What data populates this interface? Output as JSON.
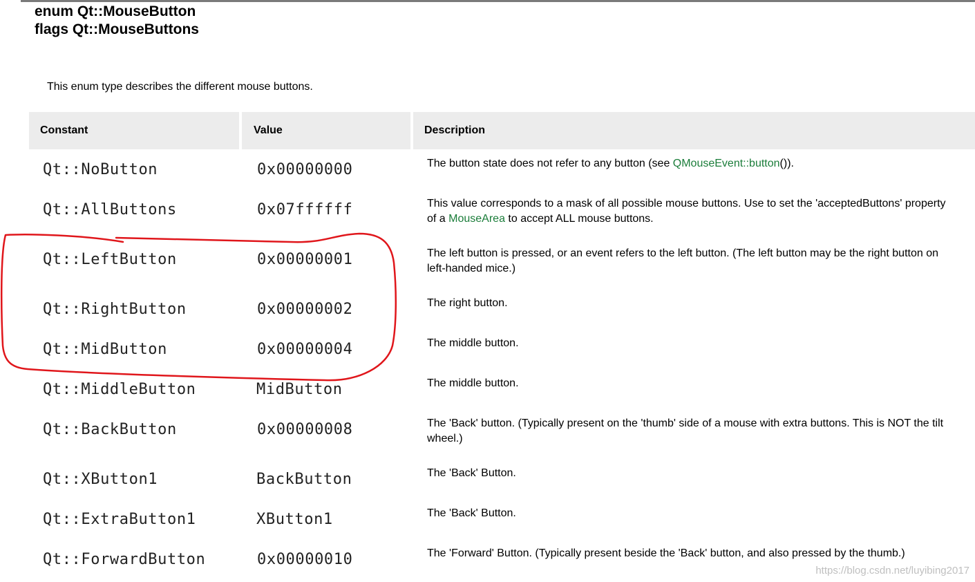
{
  "header": {
    "enum_line": "enum Qt::MouseButton",
    "flags_line": "flags Qt::MouseButtons"
  },
  "intro": "This enum type describes the different mouse buttons.",
  "table": {
    "columns": [
      "Constant",
      "Value",
      "Description"
    ],
    "rows": [
      {
        "constant": "Qt::NoButton",
        "value": "0x00000000",
        "desc": [
          {
            "text": "The button state does not refer to any button (see "
          },
          {
            "text": "QMouseEvent::button",
            "link": true
          },
          {
            "text": "())."
          }
        ],
        "desc2": ""
      },
      {
        "constant": "Qt::AllButtons",
        "value": "0x07ffffff",
        "desc": [
          {
            "text": "This value corresponds to a mask of all possible mouse buttons. Use to set the 'acceptedButtons' property"
          }
        ],
        "desc2": [
          {
            "text": "of a "
          },
          {
            "text": "MouseArea",
            "link": true
          },
          {
            "text": " to accept ALL mouse buttons."
          }
        ]
      },
      {
        "constant": "Qt::LeftButton",
        "value": "0x00000001",
        "desc": [
          {
            "text": "The left button is pressed, or an event refers to the left button. (The left button may be the right button on"
          }
        ],
        "desc2": [
          {
            "text": "left-handed mice.)"
          }
        ]
      },
      {
        "constant": "Qt::RightButton",
        "value": "0x00000002",
        "desc": [
          {
            "text": "The right button."
          }
        ],
        "desc2": ""
      },
      {
        "constant": "Qt::MidButton",
        "value": "0x00000004",
        "desc": [
          {
            "text": "The middle button."
          }
        ],
        "desc2": ""
      },
      {
        "constant": "Qt::MiddleButton",
        "value": "MidButton",
        "desc": [
          {
            "text": "The middle button."
          }
        ],
        "desc2": ""
      },
      {
        "constant": "Qt::BackButton",
        "value": "0x00000008",
        "desc": [
          {
            "text": "The 'Back' button. (Typically present on the 'thumb' side of a mouse with extra buttons. This is NOT the tilt"
          }
        ],
        "desc2": [
          {
            "text": "wheel.)"
          }
        ]
      },
      {
        "constant": "Qt::XButton1",
        "value": "BackButton",
        "desc": [
          {
            "text": "The 'Back' Button."
          }
        ],
        "desc2": ""
      },
      {
        "constant": "Qt::ExtraButton1",
        "value": "XButton1",
        "desc": [
          {
            "text": "The 'Back' Button."
          }
        ],
        "desc2": ""
      },
      {
        "constant": "Qt::ForwardButton",
        "value": "0x00000010",
        "desc": [
          {
            "text": "The 'Forward' Button. (Typically present beside the 'Back' button, and also pressed by the thumb.)"
          }
        ],
        "desc2": ""
      }
    ]
  },
  "watermark": "https://blog.csdn.net/luyibing2017",
  "colors": {
    "link": "#1b7d3a",
    "header_bg": "#ececec",
    "annotation": "#e0161b"
  }
}
